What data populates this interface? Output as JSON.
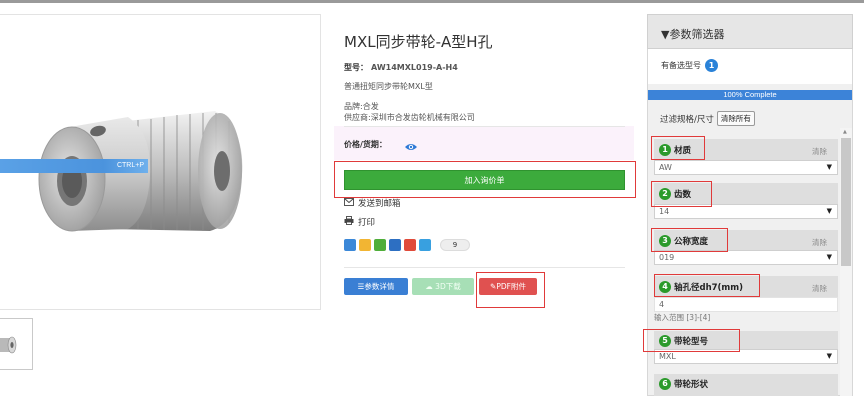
{
  "product": {
    "title": "MXL同步带轮-A型H孔",
    "model_label": "型号：",
    "model_value": "AW14MXL019-A-H4",
    "description": "普通扭矩同步带轮MXL型",
    "brand": "品牌:合发",
    "supplier": "供应商:深圳市合发齿轮机械有限公司",
    "price_label": "价格/货期：",
    "ctrl_hint": "CTRL+P"
  },
  "actions": {
    "add_to_inquiry": "加入询价单",
    "send_email": "发送到邮箱",
    "print": "打印",
    "share_count": "9",
    "param_details": "参数详情",
    "download_3d": "3D下载",
    "pdf_attachment": "PDF附件"
  },
  "filter_panel": {
    "title": "▼参数筛选器",
    "alt_models_label": "有备选型号",
    "alt_models_count": "1",
    "progress_text": "100% Complete",
    "progress_fraction": 1.0,
    "filter_size_label": "过滤规格/尺寸",
    "clear_all": "清除所有",
    "sections": [
      {
        "num": "1",
        "label": "材质",
        "clear": "清除",
        "value": "AW",
        "has_dropdown": true
      },
      {
        "num": "2",
        "label": "齿数",
        "clear": "",
        "value": "14",
        "has_dropdown": true
      },
      {
        "num": "3",
        "label": "公称宽度",
        "clear": "清除",
        "value": "019",
        "has_dropdown": true
      },
      {
        "num": "4",
        "label": "轴孔径dh7(mm)",
        "clear": "清除",
        "value": "4",
        "has_dropdown": false,
        "range_note": "输入范围 [3]-[4]"
      },
      {
        "num": "5",
        "label": "带轮型号",
        "clear": "",
        "value": "MXL",
        "has_dropdown": true
      },
      {
        "num": "6",
        "label": "带轮形状",
        "clear": "",
        "value": "",
        "has_dropdown": false
      }
    ]
  },
  "colors": {
    "accent_blue": "#3a7fd4",
    "add_green": "#3cab3c",
    "pdf_red": "#e05150",
    "highlight_red": "#e03a3a",
    "step_green": "#2b9a2b"
  }
}
